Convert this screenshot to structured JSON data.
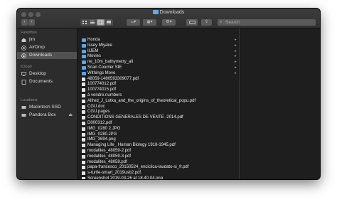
{
  "window": {
    "title": "Downloads"
  },
  "toolbar": {
    "back_label": "‹",
    "forward_label": "›",
    "view_icons": [
      "icon-view-icon",
      "list-view-icon",
      "column-view-icon",
      "gallery-view-icon"
    ],
    "group_label": "▾",
    "arrange_label": "▾",
    "action_label": "▾",
    "search_placeholder": "Search"
  },
  "sidebar": {
    "favorites_header": "Favorites",
    "favorites": [
      {
        "label": "jim",
        "icon": "home-icon",
        "selected": false
      },
      {
        "label": "AirDrop",
        "icon": "airdrop-icon",
        "selected": false
      },
      {
        "label": "Downloads",
        "icon": "downloads-icon",
        "selected": true
      }
    ],
    "icloud_header": "iCloud",
    "icloud": [
      {
        "label": "Desktop",
        "icon": "desktop-icon"
      },
      {
        "label": "Documents",
        "icon": "documents-icon"
      }
    ],
    "locations_header": "Locations",
    "locations": [
      {
        "label": "Macintosh SSD",
        "icon": "disk-icon"
      },
      {
        "label": "Pandora Box",
        "icon": "disk-icon",
        "eject": "⏏"
      }
    ]
  },
  "files": [
    {
      "name": "Honda",
      "type": "folder"
    },
    {
      "name": "Issey Miyake",
      "type": "folder"
    },
    {
      "name": "IIJEM",
      "type": "folder"
    },
    {
      "name": "Movies",
      "type": "folder"
    },
    {
      "name": "ne_10m_bathymetry_all",
      "type": "folder"
    },
    {
      "name": "Scan Courrier SIE",
      "type": "folder"
    },
    {
      "name": "Withings Move",
      "type": "folder"
    },
    {
      "name": "48059-1480593309077.pdf",
      "type": "file"
    },
    {
      "name": "100774012.pdf",
      "type": "file"
    },
    {
      "name": "100774015.pdf",
      "type": "file"
    },
    {
      "name": "à vendre.numbers",
      "type": "file"
    },
    {
      "name": "Alfred_J_Lotka_and_the_origins_of_theoretical_popu.pdf",
      "type": "file"
    },
    {
      "name": "CGU.doc",
      "type": "file"
    },
    {
      "name": "CGU.pages",
      "type": "file"
    },
    {
      "name": "CONDITIONS GENERALES DE VENTE -2014.pdf",
      "type": "file"
    },
    {
      "name": "D000312.pdf",
      "type": "file"
    },
    {
      "name": "IMG_0280 2.JPG",
      "type": "file"
    },
    {
      "name": "IMG_0280.JPG",
      "type": "file"
    },
    {
      "name": "IMG_3694.png",
      "type": "file"
    },
    {
      "name": "Managing Life_ Human Biology 1918-1945.pdf",
      "type": "file"
    },
    {
      "name": "modalites_48059-2.pdf",
      "type": "file"
    },
    {
      "name": "modalites_48059-3.pdf",
      "type": "file"
    },
    {
      "name": "modalites_48059.pdf",
      "type": "file"
    },
    {
      "name": "papa-francesco_20150524_enciclica-laudato-si_fr.pdf",
      "type": "file"
    },
    {
      "name": "s-turtle-smart_2019usb2.pdf",
      "type": "file"
    },
    {
      "name": "Screenshot 2019-03-26 at 18.40.04.png",
      "type": "file"
    },
    {
      "name": "Screenshot 2019-03-27 at 22.52.33.png",
      "type": "file"
    }
  ],
  "folder_chevron": "▸"
}
